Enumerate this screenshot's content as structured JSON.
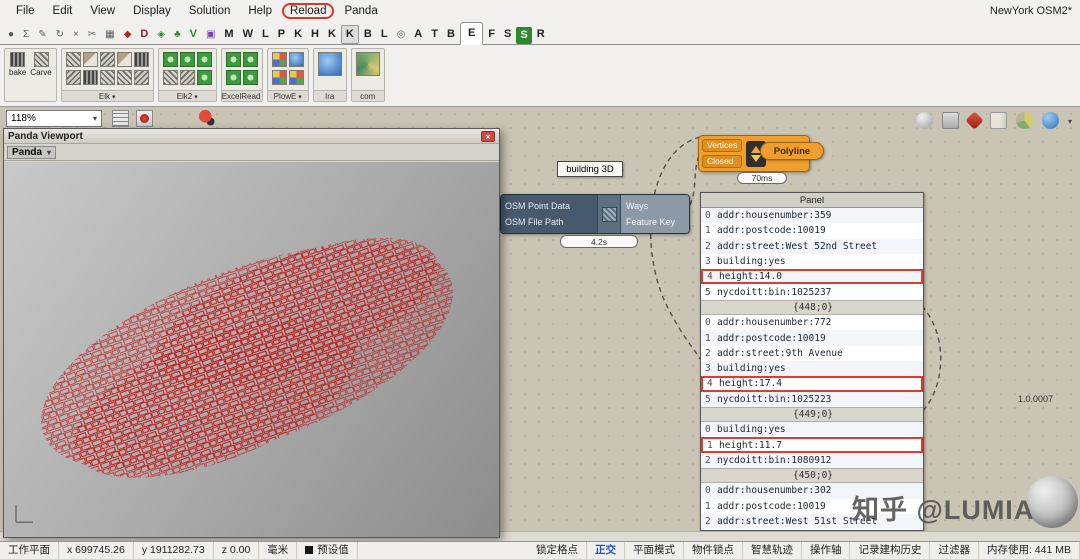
{
  "menubar": {
    "items": [
      {
        "label": "File"
      },
      {
        "label": "Edit"
      },
      {
        "label": "View"
      },
      {
        "label": "Display"
      },
      {
        "label": "Solution"
      },
      {
        "label": "Help"
      },
      {
        "label": "Reload",
        "kind": "annotated"
      },
      {
        "label": "Panda"
      }
    ],
    "document_title": "NewYork OSM2*"
  },
  "tabbar": {
    "tabs": [
      {
        "label": "●",
        "kind": "ticon"
      },
      {
        "label": "Σ",
        "kind": "ticon"
      },
      {
        "label": "✎",
        "kind": "ticon"
      },
      {
        "label": "↻",
        "kind": "ticon"
      },
      {
        "label": "×",
        "kind": "ticon"
      },
      {
        "label": "✂",
        "kind": "ticon"
      },
      {
        "label": "▦",
        "kind": "ticon"
      },
      {
        "label": "◆",
        "kind": "ticon red"
      },
      {
        "label": "D",
        "kind": "darkred"
      },
      {
        "label": "◈",
        "kind": "ticon green"
      },
      {
        "label": "♣",
        "kind": "ticon green"
      },
      {
        "label": "V",
        "kind": "green"
      },
      {
        "label": "▣",
        "kind": "ticon purple"
      },
      {
        "label": "M"
      },
      {
        "label": "W"
      },
      {
        "label": "L"
      },
      {
        "label": "P"
      },
      {
        "label": "K"
      },
      {
        "label": "H"
      },
      {
        "label": "K"
      },
      {
        "label": "K",
        "kind": "badge"
      },
      {
        "label": "B"
      },
      {
        "label": "L"
      },
      {
        "label": "◎",
        "kind": "ticon"
      },
      {
        "label": "A"
      },
      {
        "label": "T"
      },
      {
        "label": "B"
      },
      {
        "label": "E",
        "kind": "active"
      },
      {
        "label": "F"
      },
      {
        "label": "S"
      },
      {
        "label": "S",
        "kind": "greenbadge"
      },
      {
        "label": "R"
      }
    ]
  },
  "toolbar": {
    "bake_label": "bake",
    "carve_label": "Carve",
    "groups": [
      "Elk",
      "Elk2",
      "ExcelRead",
      "PlowE",
      "Ira",
      "com"
    ]
  },
  "canvas": {
    "zoom": "118%",
    "building_label": "building 3D",
    "osm": {
      "inputs": [
        "OSM Point Data",
        "OSM File Path"
      ],
      "outputs": [
        "Ways",
        "Feature Key"
      ],
      "time": "4.2s"
    },
    "polyline": {
      "inputs": [
        "Vertices",
        "Closed"
      ],
      "label": "Polyline",
      "time": "70ms"
    },
    "panel": {
      "title": "Panel",
      "rows": [
        {
          "i": "0",
          "t": "addr:housenumber:359"
        },
        {
          "i": "1",
          "t": "addr:postcode:10019"
        },
        {
          "i": "2",
          "t": "addr:street:West 52nd Street"
        },
        {
          "i": "3",
          "t": "building:yes"
        },
        {
          "i": "4",
          "t": "height:14.0",
          "kind": "hl"
        },
        {
          "i": "5",
          "t": "nycdoitt:bin:1025237"
        },
        {
          "t": "{448;0}",
          "kind": "sep"
        },
        {
          "i": "0",
          "t": "addr:housenumber:772"
        },
        {
          "i": "1",
          "t": "addr:postcode:10019"
        },
        {
          "i": "2",
          "t": "addr:street:9th Avenue"
        },
        {
          "i": "3",
          "t": "building:yes"
        },
        {
          "i": "4",
          "t": "height:17.4",
          "kind": "hl"
        },
        {
          "i": "5",
          "t": "nycdoitt:bin:1025223"
        },
        {
          "t": "{449;0}",
          "kind": "sep"
        },
        {
          "i": "0",
          "t": "building:yes"
        },
        {
          "i": "1",
          "t": "height:11.7",
          "kind": "hl"
        },
        {
          "i": "2",
          "t": "nycdoitt:bin:1080912"
        },
        {
          "t": "{450;0}",
          "kind": "sep"
        },
        {
          "i": "0",
          "t": "addr:housenumber:302"
        },
        {
          "i": "1",
          "t": "addr:postcode:10019"
        },
        {
          "i": "2",
          "t": "addr:street:West 51st Street"
        }
      ]
    },
    "version": "1.0.0007",
    "watermark": "知乎 @LUMIA"
  },
  "viewport_window": {
    "title": "Panda Viewport",
    "menu_label": "Panda",
    "close_label": "×"
  },
  "statusbar": {
    "left": [
      {
        "label": "工作平面"
      },
      {
        "label": "x 699745.26"
      },
      {
        "label": "y 1911282.73"
      },
      {
        "label": "z 0.00"
      },
      {
        "label": "毫米"
      },
      {
        "label": "预设值",
        "kind": "swatch"
      }
    ],
    "right": [
      {
        "label": "锁定格点"
      },
      {
        "label": "正交",
        "kind": "active"
      },
      {
        "label": "平面模式"
      },
      {
        "label": "物件锁点"
      },
      {
        "label": "智慧轨迹"
      },
      {
        "label": "操作轴"
      },
      {
        "label": "记录建构历史"
      },
      {
        "label": "过滤器"
      },
      {
        "label": "内存使用: 441 MB"
      }
    ]
  }
}
